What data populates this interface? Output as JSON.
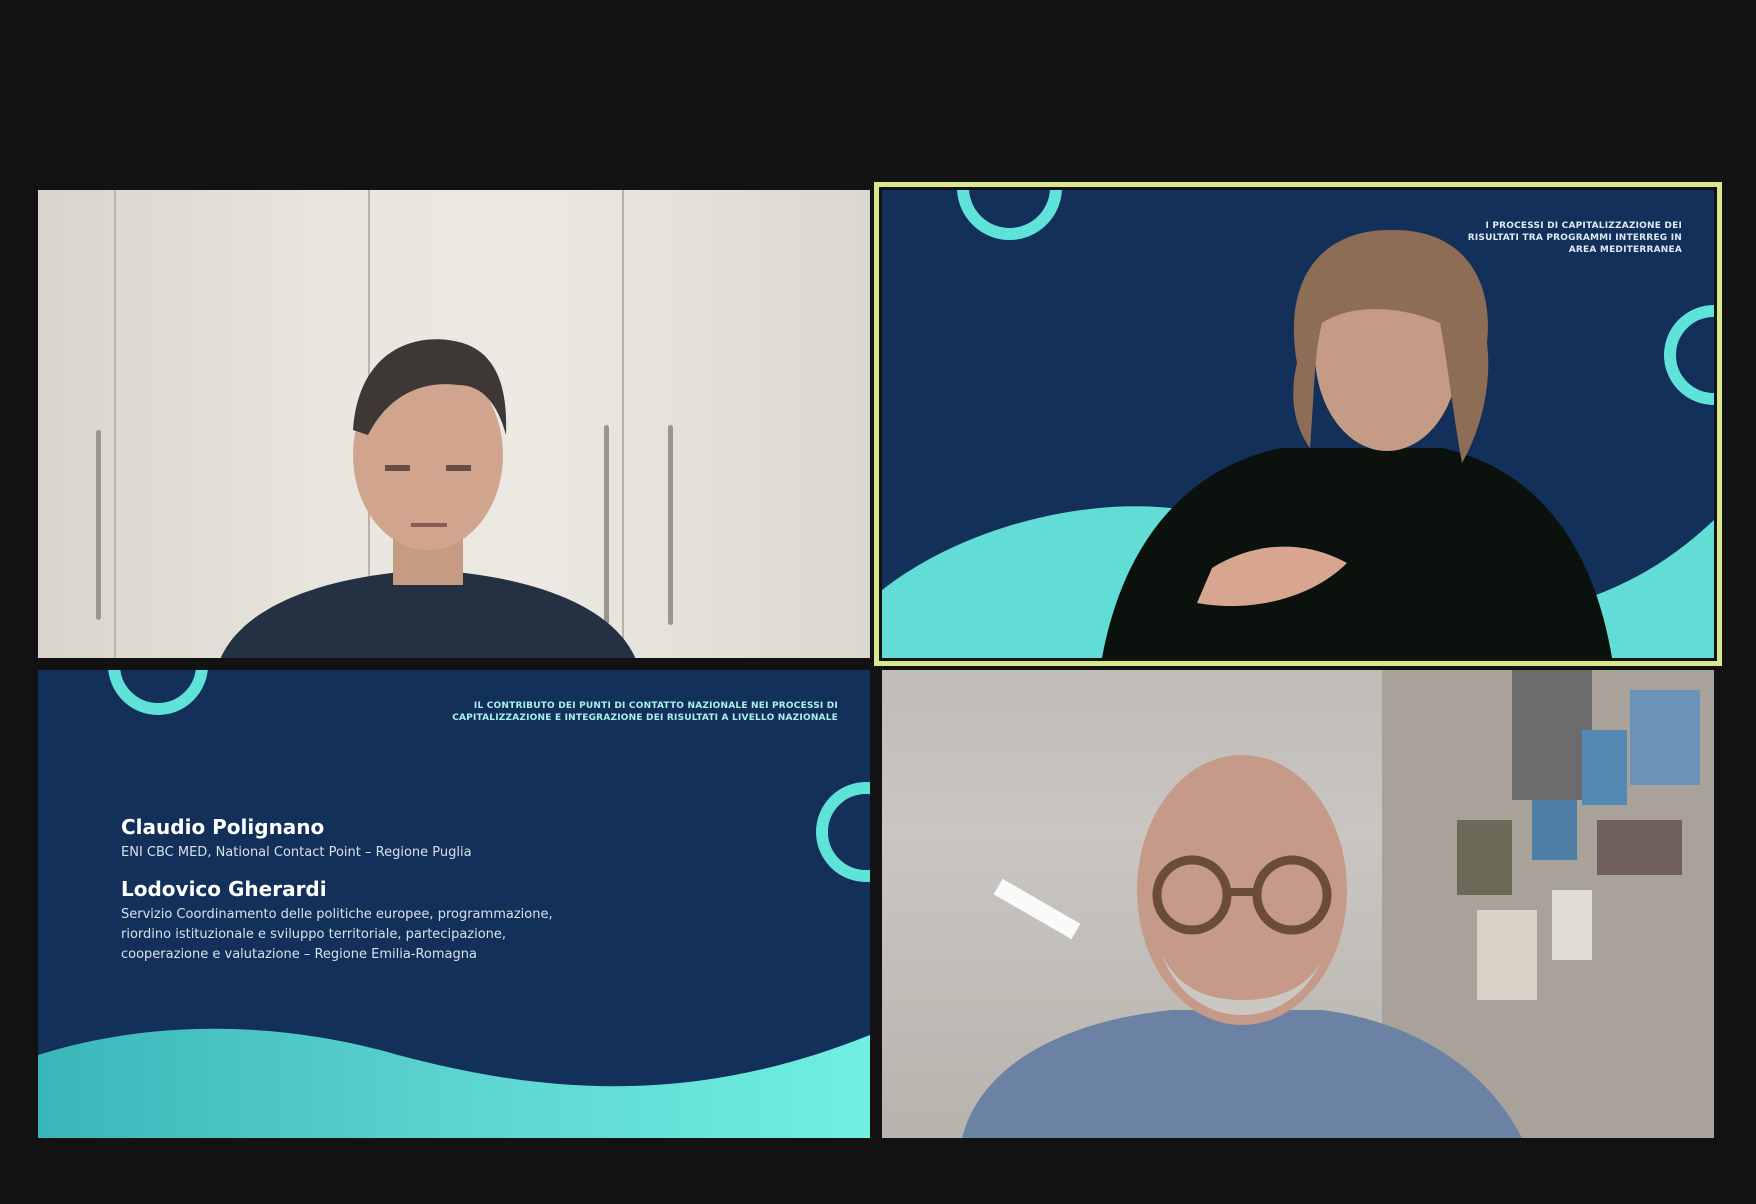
{
  "meeting": {
    "tiles": [
      {
        "id": "participant-1"
      },
      {
        "id": "participant-2",
        "slide_title": "I PROCESSI DI CAPITALIZZAZIONE DEI RISULTATI TRA PROGRAMMI INTERREG IN AREA MEDITERRANEA",
        "active_speaker": true
      },
      {
        "id": "shared-slide",
        "slide_title": "IL CONTRIBUTO DEI PUNTI DI CONTATTO NAZIONALE NEI PROCESSI DI CAPITALIZZAZIONE E INTEGRAZIONE DEI RISULTATI A LIVELLO NAZIONALE",
        "speakers": [
          {
            "name": "Claudio Polignano",
            "role": "ENI CBC MED, National Contact Point – Regione Puglia"
          },
          {
            "name": "Lodovico Gherardi",
            "role": "Servizio Coordinamento delle politiche europee, programmazione, riordino istituzionale e sviluppo territoriale, partecipazione, cooperazione e valutazione – Regione Emilia-Romagna"
          }
        ]
      },
      {
        "id": "participant-4"
      }
    ]
  },
  "colors": {
    "app_background": "#121212",
    "active_speaker_border": "#d8e88a",
    "slide_navy": "#12305a",
    "slide_teal": "#5fe3d8"
  }
}
